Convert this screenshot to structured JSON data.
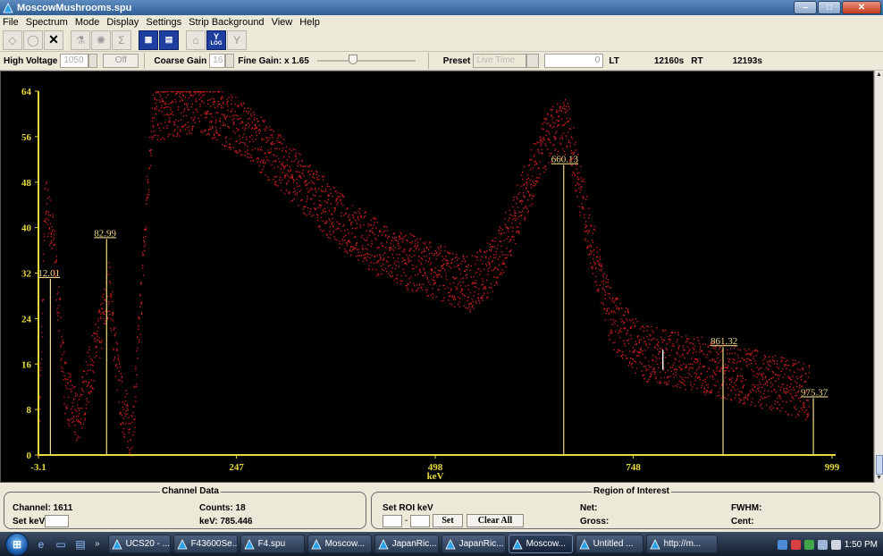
{
  "window": {
    "title": "MoscowMushrooms.spu",
    "controls": [
      "minimize",
      "maximize",
      "close"
    ]
  },
  "menu": [
    "File",
    "Spectrum",
    "Mode",
    "Display",
    "Settings",
    "Strip Background",
    "View",
    "Help"
  ],
  "toolbar": {
    "buttons": [
      "open-icon",
      "save-icon",
      "close-icon",
      "calibrate-icon",
      "clear-icon",
      "sum-icon",
      "display-a-icon",
      "display-b-icon",
      "home-icon",
      "log-scale-icon",
      "peak-icon"
    ],
    "log_label": "LOG",
    "y_label": "Y"
  },
  "controls": {
    "hv_label": "High Voltage",
    "hv_value": "1050",
    "hv_toggle": "Off",
    "coarse_gain_label": "Coarse Gain",
    "coarse_gain_value": "16",
    "fine_gain_label": "Fine Gain: x 1.65",
    "fine_gain_level": 0.35,
    "preset_label": "Preset",
    "preset_value": "Live Time",
    "preset_input": "0",
    "lt_label": "LT",
    "lt_value": "12160s",
    "rt_label": "RT",
    "rt_value": "12193s"
  },
  "chart_data": {
    "type": "scatter",
    "xlabel": "keV",
    "xlim": [
      -3.1,
      999
    ],
    "ylim": [
      0,
      64
    ],
    "x_ticks": [
      "-3.1",
      "247",
      "498",
      "748",
      "999"
    ],
    "y_ticks": [
      "0",
      "8",
      "16",
      "24",
      "32",
      "40",
      "48",
      "56",
      "64"
    ],
    "background": "#000000",
    "point_color": "#c21f1f",
    "axis_color": "#e7d93c",
    "marker_color": "#f0d98a",
    "peaks": [
      {
        "label": "12.01",
        "kev": 12.01,
        "height": 31
      },
      {
        "label": "82.99",
        "kev": 82.99,
        "height": 38
      },
      {
        "label": "660.13",
        "kev": 660.13,
        "height": 51
      },
      {
        "label": "861.32",
        "kev": 861.32,
        "height": 19
      },
      {
        "label": "975.37",
        "kev": 975.37,
        "height": 10
      }
    ],
    "cursor_kev": 785.4,
    "envelope": [
      {
        "kev": -3.1,
        "counts": 2
      },
      {
        "kev": 5,
        "counts": 45
      },
      {
        "kev": 15,
        "counts": 38
      },
      {
        "kev": 30,
        "counts": 12
      },
      {
        "kev": 45,
        "counts": 6
      },
      {
        "kev": 60,
        "counts": 14
      },
      {
        "kev": 75,
        "counts": 22
      },
      {
        "kev": 85,
        "counts": 30
      },
      {
        "kev": 100,
        "counts": 10
      },
      {
        "kev": 115,
        "counts": 3
      },
      {
        "kev": 140,
        "counts": 60
      },
      {
        "kev": 200,
        "counts": 62
      },
      {
        "kev": 260,
        "counts": 57
      },
      {
        "kev": 320,
        "counts": 49
      },
      {
        "kev": 380,
        "counts": 41
      },
      {
        "kev": 440,
        "counts": 35
      },
      {
        "kev": 490,
        "counts": 33
      },
      {
        "kev": 540,
        "counts": 30
      },
      {
        "kev": 575,
        "counts": 34
      },
      {
        "kev": 610,
        "counts": 46
      },
      {
        "kev": 640,
        "counts": 56
      },
      {
        "kev": 665,
        "counts": 58
      },
      {
        "kev": 690,
        "counts": 40
      },
      {
        "kev": 720,
        "counts": 24
      },
      {
        "kev": 760,
        "counts": 18
      },
      {
        "kev": 800,
        "counts": 17
      },
      {
        "kev": 860,
        "counts": 15
      },
      {
        "kev": 920,
        "counts": 13
      },
      {
        "kev": 970,
        "counts": 11
      }
    ]
  },
  "channel_data": {
    "title": "Channel Data",
    "channel_label": "Channel: 1611",
    "counts_label": "Counts: 18",
    "set_kev_label": "Set keV",
    "kev_label": "keV: 785.446"
  },
  "roi": {
    "title": "Region of Interest",
    "set_roi_label": "Set ROI keV",
    "set_button": "Set",
    "clear_button": "Clear All",
    "net_label": "Net:",
    "gross_label": "Gross:",
    "fwhm_label": "FWHM:",
    "cent_label": "Cent:"
  },
  "taskbar": {
    "more": "»",
    "tasks": [
      "UCS20 - ...",
      "F43600Se...",
      "F4.spu",
      "Moscow...",
      "JapanRic...",
      "JapanRic...",
      "Moscow...",
      "Untitled ...",
      "http://m..."
    ],
    "active_task": 6,
    "clock": "1:50 PM"
  }
}
